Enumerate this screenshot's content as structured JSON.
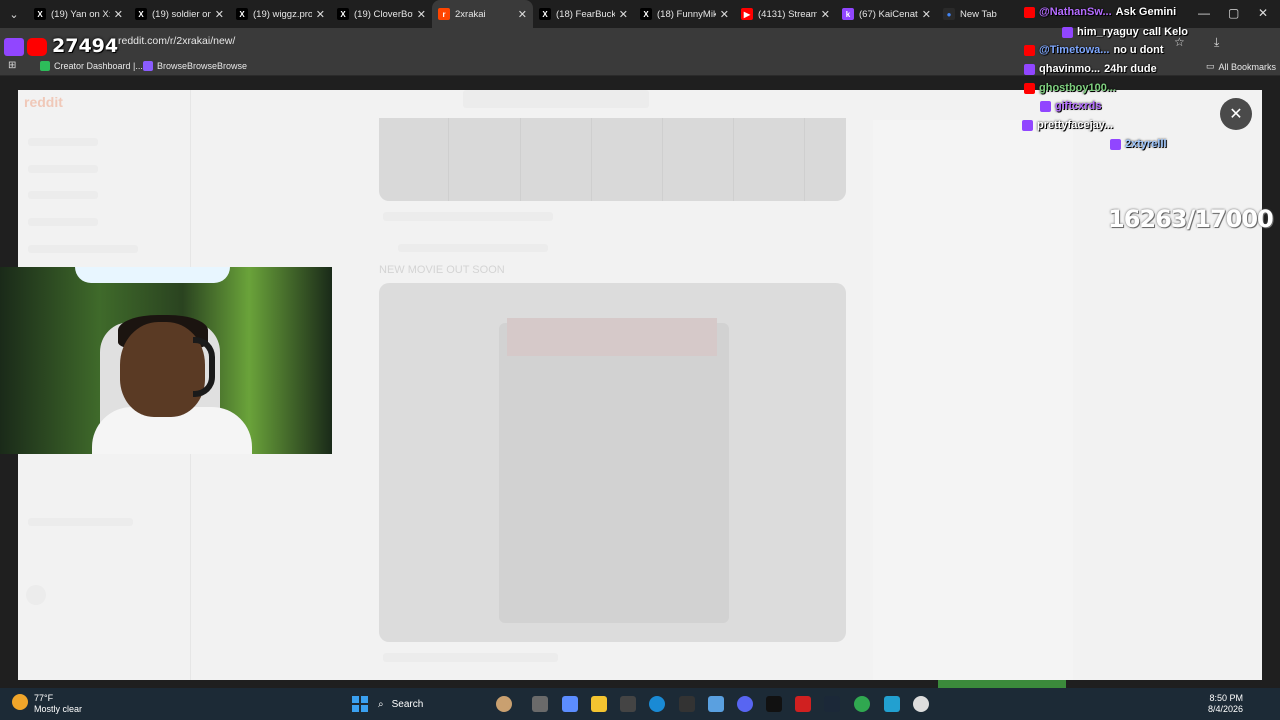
{
  "tabs": [
    {
      "label": "(19) Yan on X:",
      "fav": "X",
      "favbg": "#000000",
      "favfg": "#ffffff"
    },
    {
      "label": "(19) soldier on",
      "fav": "X",
      "favbg": "#000000",
      "favfg": "#ffffff"
    },
    {
      "label": "(19) wiggz.pro",
      "fav": "X",
      "favbg": "#000000",
      "favfg": "#ffffff"
    },
    {
      "label": "(19) CloverBoy",
      "fav": "X",
      "favbg": "#000000",
      "favfg": "#ffffff"
    },
    {
      "label": "2xrakai",
      "fav": "r",
      "favbg": "#ff4500",
      "favfg": "#ffffff"
    },
    {
      "label": "(18) FearBuck",
      "fav": "X",
      "favbg": "#000000",
      "favfg": "#ffffff"
    },
    {
      "label": "(18) FunnyMik",
      "fav": "X",
      "favbg": "#000000",
      "favfg": "#ffffff"
    },
    {
      "label": "(4131) Stream",
      "fav": "▶",
      "favbg": "#ff0000",
      "favfg": "#ffffff"
    },
    {
      "label": "(67) KaiCenat",
      "fav": "k",
      "favbg": "#9146ff",
      "favfg": "#ffffff"
    },
    {
      "label": "New Tab",
      "fav": "●",
      "favbg": "#2a2a2a",
      "favfg": "#4285f4"
    }
  ],
  "address": {
    "url": "reddit.com/r/2xrakai/new/"
  },
  "bookmarks": {
    "creator": "Creator Dashboard |...",
    "browse": "BrowseBrowseBrowse",
    "all": "All Bookmarks"
  },
  "page": {
    "post_title": "NEW MOVIE OUT SOON"
  },
  "stream": {
    "viewer_count": "27494",
    "goal_progress": "16263/17000"
  },
  "chat": [
    {
      "user": "@NathanSw...",
      "msg": "Ask Gemini",
      "color": "#b46cff",
      "icon": "#ff0000"
    },
    {
      "user": "him_ryaguy",
      "msg": "call Kelo",
      "color": "#ffffff",
      "icon": "#9146ff"
    },
    {
      "user": "@Timetowa...",
      "msg": "no u dont",
      "color": "#7fa8ff",
      "icon": "#ff0000"
    },
    {
      "user": "qhavinmo...",
      "msg": "24hr dude",
      "color": "#ffffff",
      "icon": "#9146ff"
    },
    {
      "user": "ghostboy100...",
      "msg": "",
      "color": "#7fd07f",
      "icon": "#ff0000"
    },
    {
      "user": "giftcxrds",
      "msg": "",
      "color": "#b46cff",
      "icon": "#9146ff"
    },
    {
      "user": "prettyfacejay...",
      "msg": "",
      "color": "#ffffff",
      "icon": "#9146ff"
    },
    {
      "user": "2xtyrelll",
      "msg": "",
      "color": "#a0c8ff",
      "icon": "#9146ff"
    }
  ],
  "taskbar": {
    "temp": "77°F",
    "weather": "Mostly clear",
    "search": "Search",
    "time": "8:50 PM",
    "date": "8/4/2026"
  }
}
